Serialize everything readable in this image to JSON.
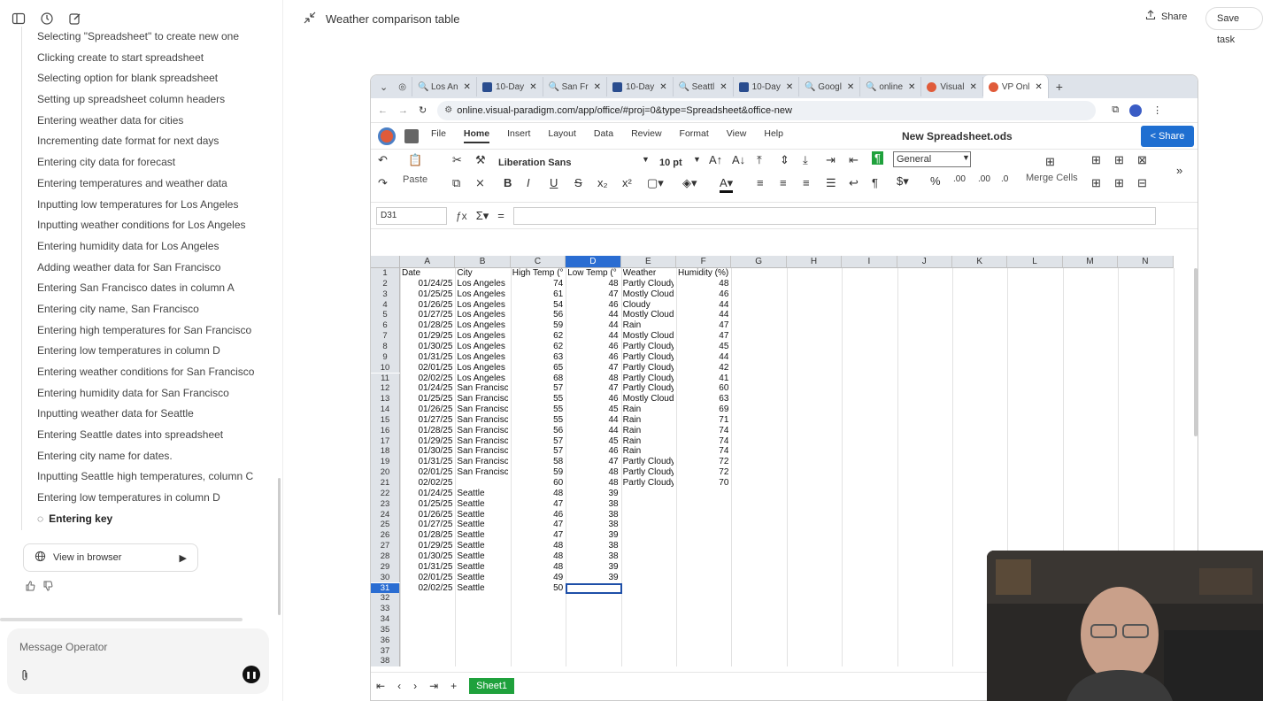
{
  "left": {
    "steps": [
      "Selecting \"Spreadsheet\" to create new one",
      "Clicking create to start spreadsheet",
      "Selecting option for blank spreadsheet",
      "Setting up spreadsheet column headers",
      "Entering weather data for cities",
      "Incrementing date format for next days",
      "Entering city data for forecast",
      "Entering temperatures and weather data",
      "Inputting low temperatures for Los Angeles",
      "Inputting weather conditions for Los Angeles",
      "Entering humidity data for Los Angeles",
      "Adding weather data for San Francisco",
      "Entering San Francisco dates in column A",
      "Entering city name, San Francisco",
      "Entering high temperatures for San Francisco",
      "Entering low temperatures in column D",
      "Entering weather conditions for San Francisco",
      "Entering humidity data for San Francisco",
      "Inputting weather data for Seattle",
      "Entering Seattle dates into spreadsheet",
      "Entering city name for dates.",
      "Inputting Seattle high temperatures, column C",
      "Entering low temperatures in column D"
    ],
    "current_step": "Entering key",
    "view_in_browser": "View in browser",
    "message_placeholder": "Message Operator"
  },
  "header": {
    "title": "Weather comparison table",
    "share": "Share",
    "save_task": "Save task"
  },
  "browser": {
    "tabs": [
      {
        "label": "",
        "icon": "grid-icon"
      },
      {
        "label": "Los An",
        "icon": "search-icon"
      },
      {
        "label": "10-Day",
        "icon": "news-icon"
      },
      {
        "label": "San Fr",
        "icon": "search-icon"
      },
      {
        "label": "10-Day",
        "icon": "news-icon"
      },
      {
        "label": "Seattl",
        "icon": "search-icon"
      },
      {
        "label": "10-Day",
        "icon": "news-icon"
      },
      {
        "label": "Googl",
        "icon": "search-icon"
      },
      {
        "label": "online",
        "icon": "search-icon"
      },
      {
        "label": "Visual",
        "icon": "vp-icon"
      },
      {
        "label": "VP Onl",
        "icon": "vp-icon",
        "active": true
      }
    ],
    "url": "online.visual-paradigm.com/app/office/#proj=0&type=Spreadsheet&office-new"
  },
  "app": {
    "menu": [
      "File",
      "Home",
      "Insert",
      "Layout",
      "Data",
      "Review",
      "Format",
      "View",
      "Help"
    ],
    "active_menu": "Home",
    "doc_name": "New Spreadsheet.ods",
    "share": "Share",
    "font": "Liberation Sans",
    "size": "10 pt",
    "number_format": "General",
    "paste": "Paste",
    "merge": "Merge Cells",
    "cell_ref": "D31",
    "sheet_tab": "Sheet1"
  },
  "sheet": {
    "columns": [
      "A",
      "B",
      "C",
      "D",
      "E",
      "F",
      "G",
      "H",
      "I",
      "J",
      "K",
      "L",
      "M",
      "N"
    ],
    "selected_column": "D",
    "selected_row": 31,
    "headers": [
      "Date",
      "City",
      "High Temp (°",
      "Low Temp (°",
      "Weather",
      "Humidity (%)"
    ],
    "rows": [
      [
        "01/24/25",
        "Los Angeles",
        "74",
        "48",
        "Partly Cloudy",
        "48"
      ],
      [
        "01/25/25",
        "Los Angeles",
        "61",
        "47",
        "Mostly Cloud",
        "46"
      ],
      [
        "01/26/25",
        "Los Angeles",
        "54",
        "46",
        "Cloudy",
        "44"
      ],
      [
        "01/27/25",
        "Los Angeles",
        "56",
        "44",
        "Mostly Cloud",
        "44"
      ],
      [
        "01/28/25",
        "Los Angeles",
        "59",
        "44",
        "Rain",
        "47"
      ],
      [
        "01/29/25",
        "Los Angeles",
        "62",
        "44",
        "Mostly Cloud",
        "47"
      ],
      [
        "01/30/25",
        "Los Angeles",
        "62",
        "46",
        "Partly Cloudy",
        "45"
      ],
      [
        "01/31/25",
        "Los Angeles",
        "63",
        "46",
        "Partly Cloudy",
        "44"
      ],
      [
        "02/01/25",
        "Los Angeles",
        "65",
        "47",
        "Partly Cloudy",
        "42"
      ],
      [
        "02/02/25",
        "Los Angeles",
        "68",
        "48",
        "Partly Cloudy",
        "41"
      ],
      [
        "01/24/25",
        "San Francisc",
        "57",
        "47",
        "Partly Cloudy",
        "60"
      ],
      [
        "01/25/25",
        "San Francisc",
        "55",
        "46",
        "Mostly Cloud",
        "63"
      ],
      [
        "01/26/25",
        "San Francisc",
        "55",
        "45",
        "Rain",
        "69"
      ],
      [
        "01/27/25",
        "San Francisc",
        "55",
        "44",
        "Rain",
        "71"
      ],
      [
        "01/28/25",
        "San Francisc",
        "56",
        "44",
        "Rain",
        "74"
      ],
      [
        "01/29/25",
        "San Francisc",
        "57",
        "45",
        "Rain",
        "74"
      ],
      [
        "01/30/25",
        "San Francisc",
        "57",
        "46",
        "Rain",
        "74"
      ],
      [
        "01/31/25",
        "San Francisc",
        "58",
        "47",
        "Partly Cloudy",
        "72"
      ],
      [
        "02/01/25",
        "San Francisc",
        "59",
        "48",
        "Partly Cloudy",
        "72"
      ],
      [
        "02/02/25",
        "",
        "60",
        "48",
        "Partly Cloudy",
        "70"
      ],
      [
        "01/24/25",
        "Seattle",
        "48",
        "39",
        "",
        ""
      ],
      [
        "01/25/25",
        "Seattle",
        "47",
        "38",
        "",
        ""
      ],
      [
        "01/26/25",
        "Seattle",
        "46",
        "38",
        "",
        ""
      ],
      [
        "01/27/25",
        "Seattle",
        "47",
        "38",
        "",
        ""
      ],
      [
        "01/28/25",
        "Seattle",
        "47",
        "39",
        "",
        ""
      ],
      [
        "01/29/25",
        "Seattle",
        "48",
        "38",
        "",
        ""
      ],
      [
        "01/30/25",
        "Seattle",
        "48",
        "38",
        "",
        ""
      ],
      [
        "01/31/25",
        "Seattle",
        "48",
        "39",
        "",
        ""
      ],
      [
        "02/01/25",
        "Seattle",
        "49",
        "39",
        "",
        ""
      ],
      [
        "02/02/25",
        "Seattle",
        "50",
        "",
        "",
        ""
      ]
    ],
    "total_rows": 39
  },
  "colors": {
    "accent": "#1f6fd1",
    "green": "#1fa13c",
    "selected_header": "#2a6dd2"
  }
}
